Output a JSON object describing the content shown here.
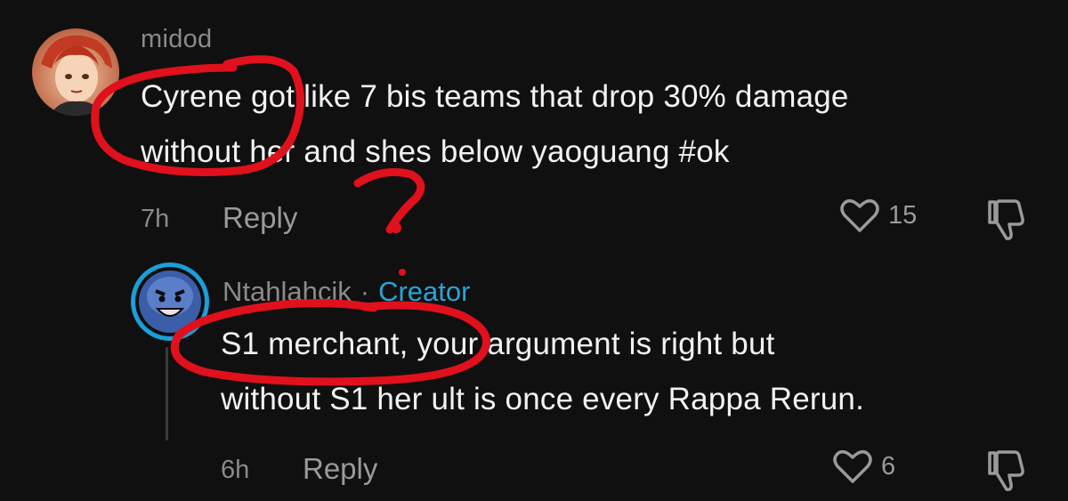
{
  "comment": {
    "username": "midod",
    "lines": [
      "Cyrene got like 7 bis teams that drop 30% damage",
      "without her and shes below yaoguang #ok"
    ],
    "time": "7h",
    "reply_label": "Reply",
    "like_count": "15"
  },
  "reply": {
    "username": "Ntahlahcik",
    "separator": "·",
    "badge": "Creator",
    "lines": [
      "S1 merchant, your argument is right but",
      "without S1 her ult is once every Rappa Rerun."
    ],
    "time": "6h",
    "reply_label": "Reply",
    "like_count": "6"
  },
  "annotation": {
    "mark": "?",
    "color": "#e0101c"
  },
  "colors": {
    "background": "#101010",
    "text": "#f2f2f2",
    "muted": "#8a8a8a",
    "creator": "#2aa3d6",
    "annotation": "#e0101c"
  }
}
